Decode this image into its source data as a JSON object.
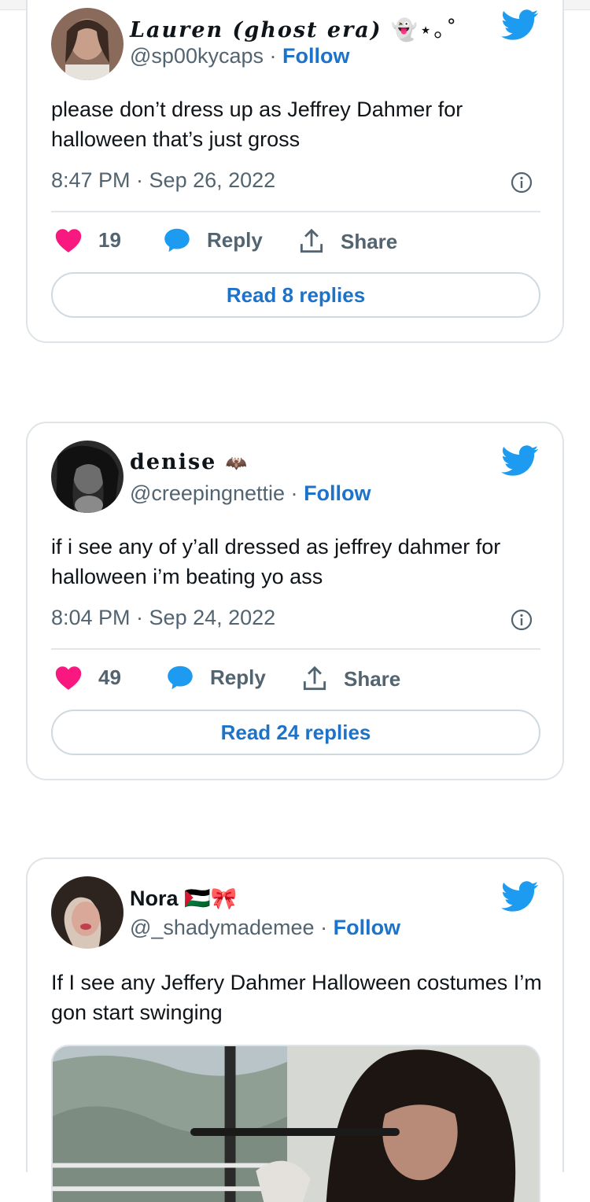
{
  "colors": {
    "twitter_blue": "#1d9bf0",
    "follow_blue": "#1d73c9",
    "like_pink": "#f91880",
    "muted_gray": "#536471",
    "border": "#dfe4e8"
  },
  "tweets": [
    {
      "display_name": "Lauren (ghost era)",
      "name_emoji": "👻⋆｡˚",
      "handle": "@sp00kycaps",
      "separator": "·",
      "follow_label": "Follow",
      "text": "please don’t dress up as Jeffrey Dahmer for halloween that’s just gross",
      "timestamp": "8:47 PM · Sep 26, 2022",
      "like_count": "19",
      "reply_label": "Reply",
      "share_label": "Share",
      "read_replies_label": "Read 8 replies",
      "icons": [
        "avatar",
        "twitter-bird-icon",
        "info-icon",
        "heart-icon",
        "reply-bubble-icon",
        "share-icon"
      ]
    },
    {
      "display_name": "denise",
      "name_emoji": "🦇",
      "handle": "@creepingnettie",
      "separator": "·",
      "follow_label": "Follow",
      "text": "if i see any of y’all dressed as jeffrey dahmer for halloween i’m beating yo ass",
      "timestamp": "8:04 PM · Sep 24, 2022",
      "like_count": "49",
      "reply_label": "Reply",
      "share_label": "Share",
      "read_replies_label": "Read 24 replies",
      "icons": [
        "avatar",
        "twitter-bird-icon",
        "info-icon",
        "heart-icon",
        "reply-bubble-icon",
        "share-icon"
      ]
    },
    {
      "display_name": "Nora",
      "name_emoji": "🇵🇸🎀",
      "handle": "@_shadymademee",
      "separator": "·",
      "follow_label": "Follow",
      "text": "If I see any Jeffery Dahmer Halloween costumes I’m gon start swinging",
      "icons": [
        "avatar",
        "twitter-bird-icon",
        "media-photo"
      ]
    }
  ]
}
